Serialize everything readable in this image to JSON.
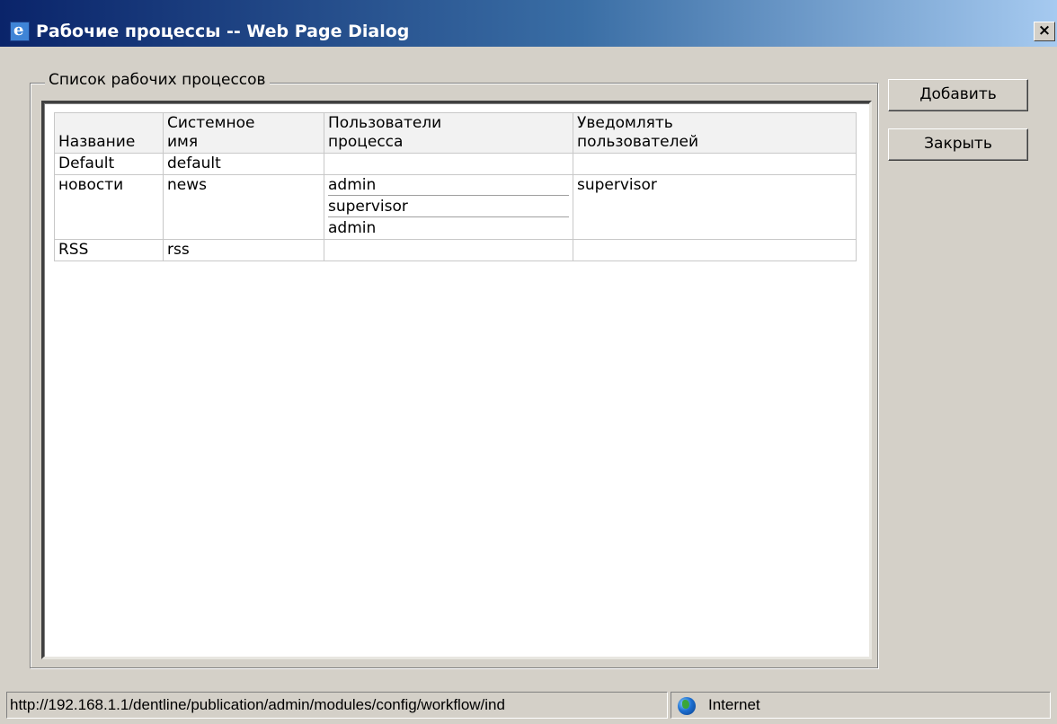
{
  "window": {
    "title": "Рабочие процессы -- Web Page Dialog",
    "icon": "ie-icon",
    "close_label": "×"
  },
  "groupbox": {
    "legend": "Список рабочих процессов"
  },
  "table": {
    "headers": [
      "Название",
      "Системное имя",
      "Пользователи процесса",
      "Уведомлять пользователей"
    ],
    "rows": [
      {
        "name": "Default",
        "system_name": "default",
        "users": [],
        "notify": ""
      },
      {
        "name": "новости",
        "system_name": "news",
        "users": [
          "admin",
          "supervisor",
          "admin"
        ],
        "notify": "supervisor"
      },
      {
        "name": "RSS",
        "system_name": "rss",
        "users": [],
        "notify": ""
      }
    ]
  },
  "buttons": {
    "add": "Добавить",
    "close": "Закрыть"
  },
  "statusbar": {
    "url": "http://192.168.1.1/dentline/publication/admin/modules/config/workflow/ind",
    "zone": "Internet",
    "zone_icon": "globe-icon"
  }
}
